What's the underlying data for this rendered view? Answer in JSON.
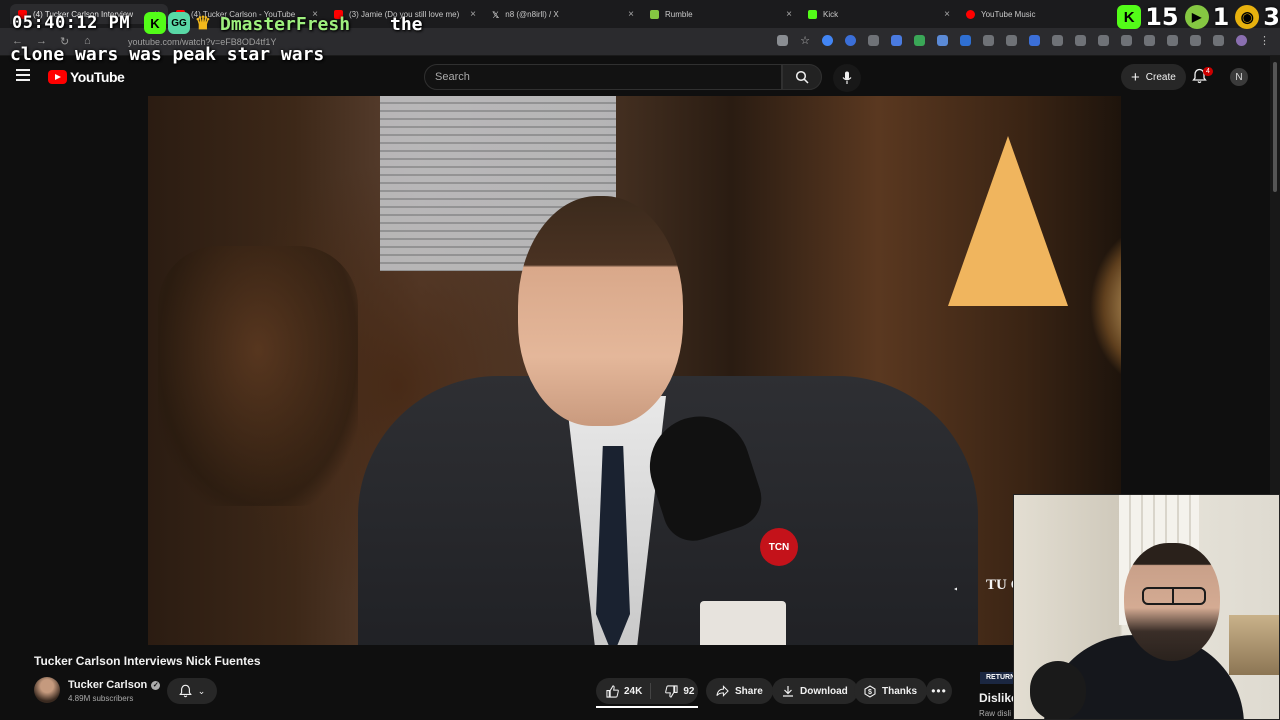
{
  "tabs": [
    {
      "label": "(4) Tucker Carlson Interview",
      "favicon_color": "#ff0000",
      "active": true
    },
    {
      "label": "(4) Tucker Carlson - YouTube",
      "favicon_color": "#ff0000",
      "active": false
    },
    {
      "label": "(3) Jamie (Do you still love me)",
      "favicon_color": "#ff0000",
      "active": false
    },
    {
      "label": "n8 (@n8irll) / X",
      "favicon_color": "#ffffff",
      "active": false
    },
    {
      "label": "Rumble",
      "favicon_color": "#85c742",
      "active": false
    },
    {
      "label": "Kick",
      "favicon_color": "#53fc18",
      "active": false
    },
    {
      "label": "YouTube Music",
      "favicon_color": "#ff0000",
      "active": false
    }
  ],
  "browser": {
    "url": "youtube.com/watch?v=eFB8OD4tf1Y"
  },
  "overlay": {
    "clock": "05:40:12 PM",
    "chat_user": "DmasterFresh",
    "chat_message_line1": "the",
    "chat_message_line2": "clone wars was peak star wars",
    "badges": [
      {
        "text": "K",
        "color": "#53fc18"
      },
      {
        "text": "GG",
        "color": "#59d8a6"
      },
      {
        "text": "♛",
        "color": "#f2b81b"
      }
    ],
    "counters": [
      {
        "icon": "kick-icon",
        "glyph": "K",
        "color": "#53fc18",
        "value": "15"
      },
      {
        "icon": "rumble-icon",
        "glyph": "▶",
        "color": "#85c742",
        "value": "1"
      },
      {
        "icon": "twitch-icon",
        "glyph": "◉",
        "color": "#e8b20e",
        "value": "3"
      }
    ]
  },
  "youtube": {
    "logo_text": "YouTube",
    "search_placeholder": "Search",
    "create_label": "Create",
    "notifications_count": "4",
    "account_initial": "N",
    "video": {
      "title": "Tucker Carlson Interviews Nick Fuentes",
      "channel": "Tucker Carlson",
      "subscribers": "4.89M subscribers",
      "likes": "24K",
      "dislikes": "92",
      "share_label": "Share",
      "download_label": "Download",
      "thanks_label": "Thanks",
      "watermark": "TU CA",
      "mic_logo": "TCN"
    },
    "sidebar_extension": {
      "badge": "RETURN",
      "title": "Dislike",
      "subtitle": "Raw disli"
    }
  }
}
